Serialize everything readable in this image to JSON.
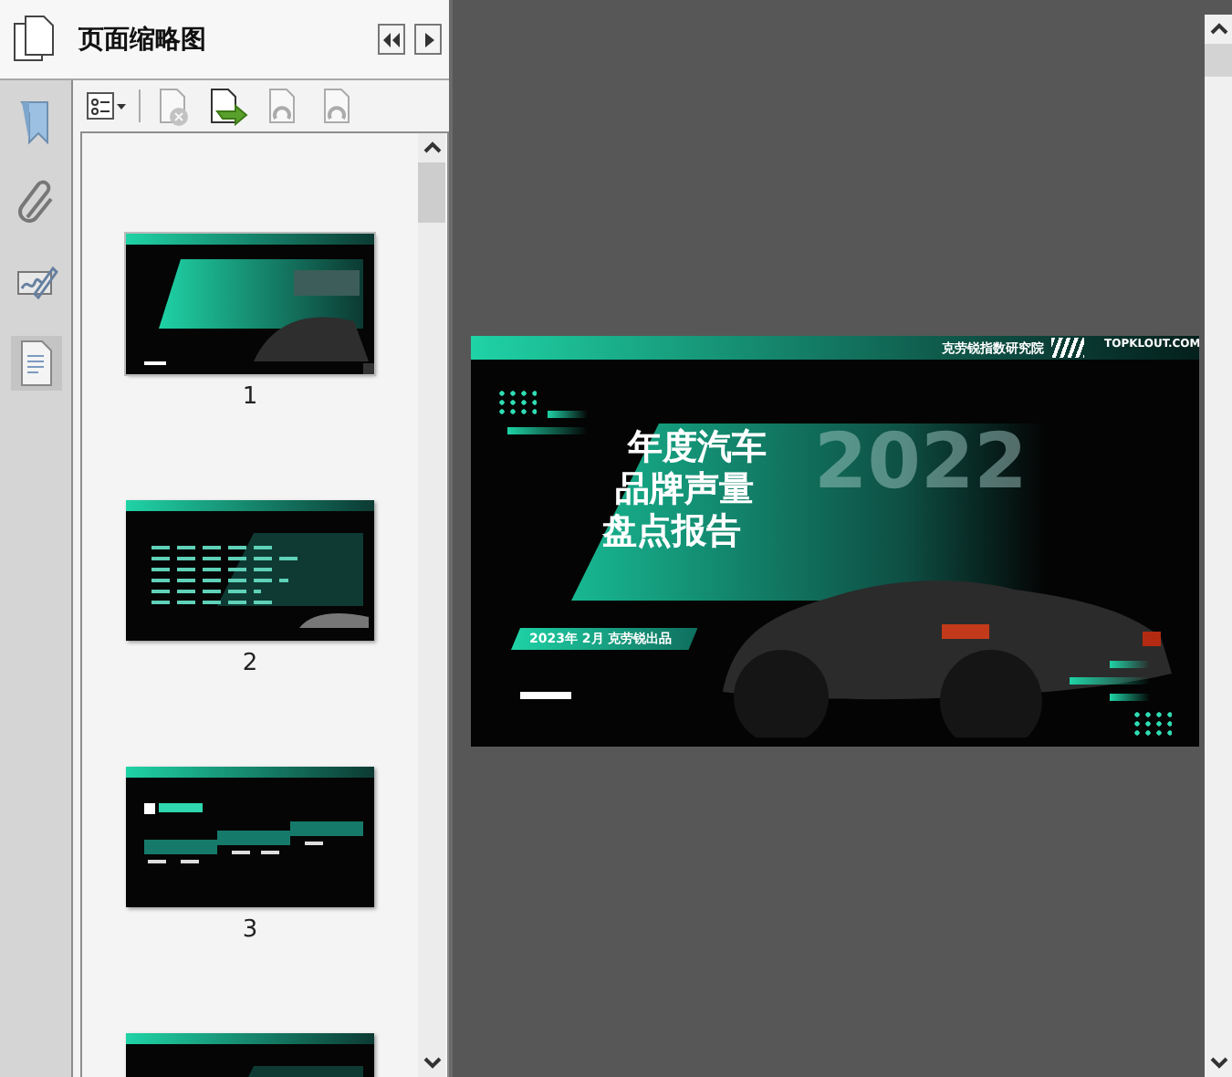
{
  "panel": {
    "title": "页面缩略图"
  },
  "nav_buttons": [
    {
      "kind": "collapse"
    },
    {
      "kind": "expand"
    }
  ],
  "sidebar": [
    {
      "kind": "bookmark",
      "selected": false
    },
    {
      "kind": "attachment",
      "selected": false
    },
    {
      "kind": "signature",
      "selected": false
    },
    {
      "kind": "page",
      "selected": true
    }
  ],
  "toolbar": [
    {
      "kind": "options",
      "disabled": false
    },
    {
      "kind": "delete",
      "disabled": true
    },
    {
      "kind": "insert",
      "disabled": false
    },
    {
      "kind": "undo",
      "disabled": true
    },
    {
      "kind": "redo",
      "disabled": true
    }
  ],
  "thumbnails": [
    {
      "kind": "cover",
      "label": "1",
      "selected": true
    },
    {
      "kind": "content",
      "label": "2",
      "selected": false
    },
    {
      "kind": "toc",
      "label": "3",
      "selected": false
    },
    {
      "kind": "content",
      "selected": false
    }
  ],
  "slide": {
    "header": "克劳锐指数研究院",
    "brand": "TOPKLOUT.COM",
    "title_lines": [
      "年度汽车",
      "品牌声量",
      "盘点报告"
    ],
    "year": "2022",
    "subtitle": "2023年 2月  克劳锐出品"
  }
}
